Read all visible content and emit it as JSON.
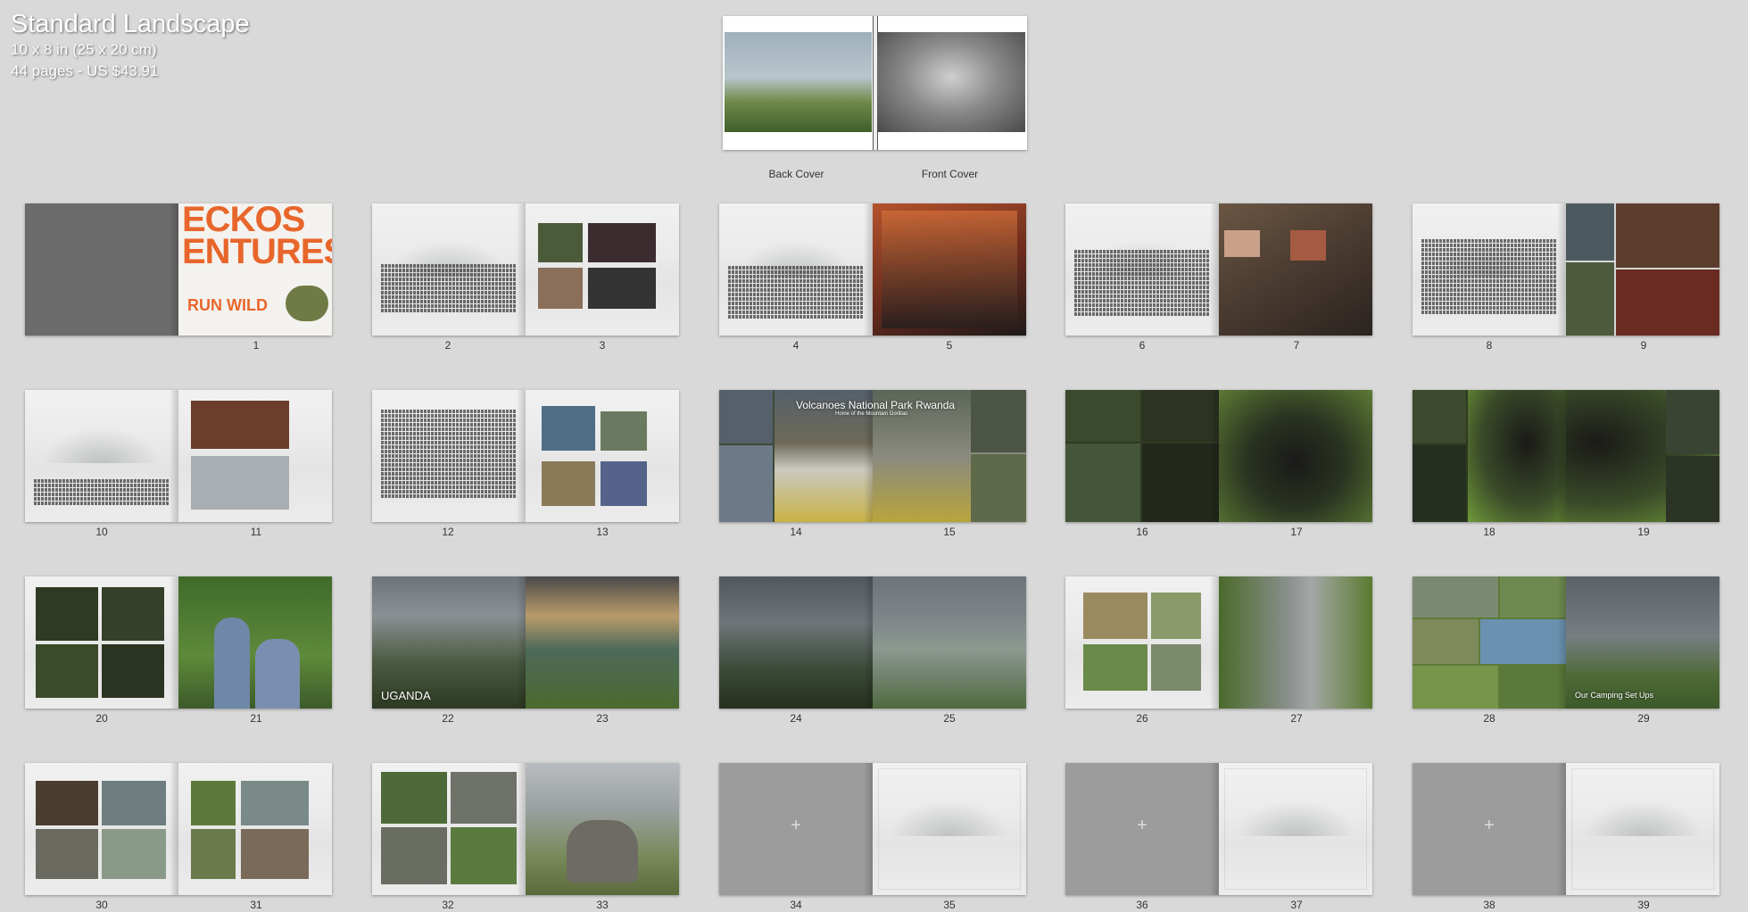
{
  "book": {
    "title": "Standard Landscape",
    "size": "10 x 8 in (25 x 20 cm)",
    "pages_price": "44 pages - US $43.91"
  },
  "cover": {
    "back_label": "Back Cover",
    "front_label": "Front Cover"
  },
  "spreads": [
    {
      "left": "1",
      "right": ""
    }
  ],
  "pages": {
    "p1": "1",
    "p2": "2",
    "p3": "3",
    "p4": "4",
    "p5": "5",
    "p6": "6",
    "p7": "7",
    "p8": "8",
    "p9": "9",
    "p10": "10",
    "p11": "11",
    "p12": "12",
    "p13": "13",
    "p14": "14",
    "p15": "15",
    "p16": "16",
    "p17": "17",
    "p18": "18",
    "p19": "19",
    "p20": "20",
    "p21": "21",
    "p22": "22",
    "p23": "23",
    "p24": "24",
    "p25": "25",
    "p26": "26",
    "p27": "27",
    "p28": "28",
    "p29": "29",
    "p30": "30",
    "p31": "31",
    "p32": "32",
    "p33": "33",
    "p34": "34",
    "p35": "35",
    "p36": "36",
    "p37": "37",
    "p38": "38",
    "p39": "39"
  },
  "captions": {
    "volcanoes_title": "Volcanoes National Park Rwanda",
    "volcanoes_sub": "Home of the Mountain Gorillas",
    "uganda": "UGANDA",
    "camping": "Our Camping Set Ups",
    "adventures_big_1": "ECKOS",
    "adventures_big_2": "ENTURES",
    "adventures_small": "RUN WILD"
  },
  "empty_page_icon": "plus-icon",
  "colors": {
    "background": "#d9d9d9",
    "accent_orange": "#e8662b"
  }
}
